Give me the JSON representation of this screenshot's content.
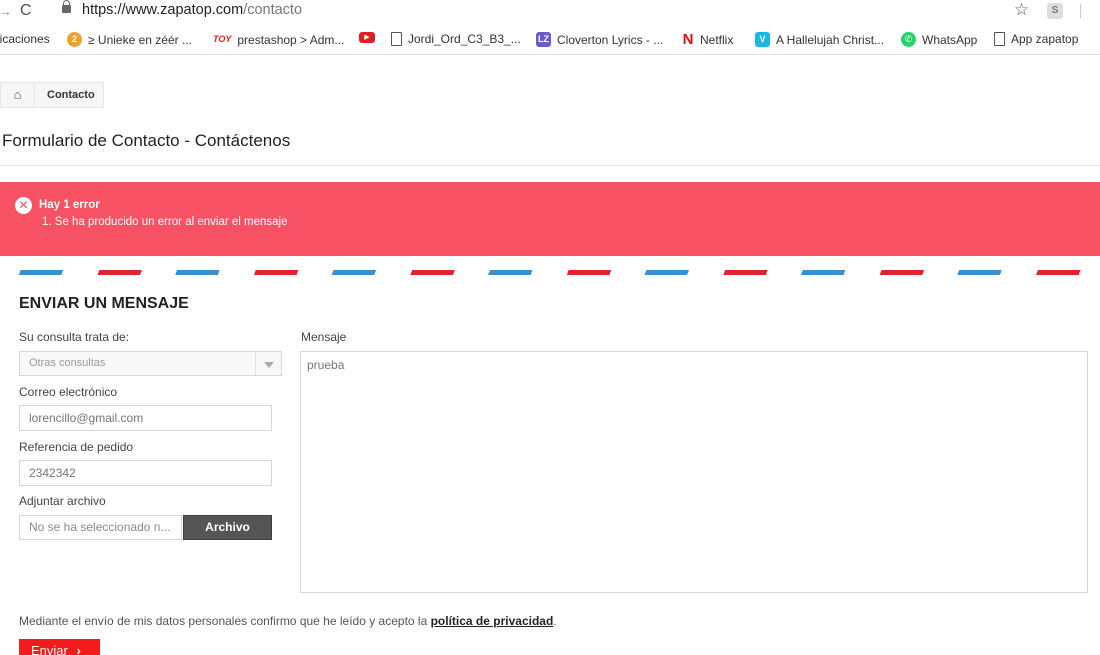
{
  "browser": {
    "url_domain": "https://www.zapatop.com",
    "url_path": "/contacto",
    "bookmarks": [
      {
        "label": "licaciones",
        "icon": ""
      },
      {
        "label": "≥ Unieke en zéér ...",
        "icon": "2",
        "color": "#f0a030"
      },
      {
        "label": "prestashop > Adm...",
        "icon": "TOY",
        "color": "#ffffff"
      },
      {
        "label": "",
        "icon": "▶",
        "color": "#e02020"
      },
      {
        "label": "Jordi_Ord_C3_B3_...",
        "icon": "doc"
      },
      {
        "label": "Cloverton Lyrics - ...",
        "icon": "LZ",
        "color": "#6a5acd"
      },
      {
        "label": "Netflix",
        "icon": "N",
        "color": "#e50914"
      },
      {
        "label": "A Hallelujah Christ...",
        "icon": "V",
        "color": "#1ab7ea"
      },
      {
        "label": "WhatsApp",
        "icon": "✆",
        "color": "#25d366"
      },
      {
        "label": "App zapatop",
        "icon": "doc"
      }
    ]
  },
  "breadcrumb": {
    "label": "Contacto"
  },
  "page_title": "Formulario de Contacto - Contáctenos",
  "alert": {
    "title": "Hay 1 error",
    "items": [
      "1. Se ha producido un error al enviar el mensaje"
    ]
  },
  "form": {
    "heading": "ENVIAR UN MENSAJE",
    "subject_label": "Su consulta trata de:",
    "subject_value": "Otras consultas",
    "email_label": "Correo electrónico",
    "email_value": "lorencillo@gmail.com",
    "order_label": "Referencia de pedido",
    "order_value": "2342342",
    "attach_label": "Adjuntar archivo",
    "attach_value": "No se ha seleccionado n...",
    "attach_button": "Archivo",
    "message_label": "Mensaje",
    "message_value": "prueba",
    "consent_text": "Mediante el envío de mis datos personales confirmo que he leído y acepto la ",
    "consent_link": "política de privacidad",
    "consent_end": ".",
    "submit_label": "Enviar"
  },
  "colors": {
    "error": "#f65264",
    "submit": "#f31b1b",
    "airmail_red": "#e0242c",
    "airmail_blue": "#3a8fd0"
  }
}
